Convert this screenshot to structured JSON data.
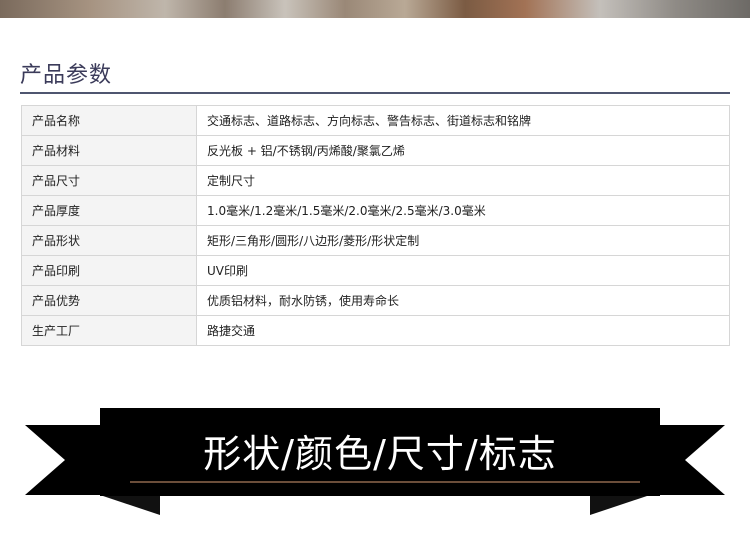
{
  "section": {
    "title": "产品参数"
  },
  "specs": [
    {
      "label": "产品名称",
      "value": "交通标志、道路标志、方向标志、警告标志、街道标志和铭牌"
    },
    {
      "label": "产品材料",
      "value": "反光板 + 铝/不锈钢/丙烯酸/聚氯乙烯"
    },
    {
      "label": "产品尺寸",
      "value": "定制尺寸"
    },
    {
      "label": "产品厚度",
      "value": "1.0毫米/1.2毫米/1.5毫米/2.0毫米/2.5毫米/3.0毫米"
    },
    {
      "label": "产品形状",
      "value": "矩形/三角形/圆形/八边形/菱形/形状定制"
    },
    {
      "label": "产品印刷",
      "value": "UV印刷"
    },
    {
      "label": "产品优势",
      "value": "优质铝材料，耐水防锈，使用寿命长"
    },
    {
      "label": "生产工厂",
      "value": "路捷交通"
    }
  ],
  "banner": {
    "text": "形状/颜色/尺寸/标志"
  },
  "colors": {
    "title": "#3b3b5a",
    "rule": "#4f5670",
    "banner": "#000000"
  }
}
